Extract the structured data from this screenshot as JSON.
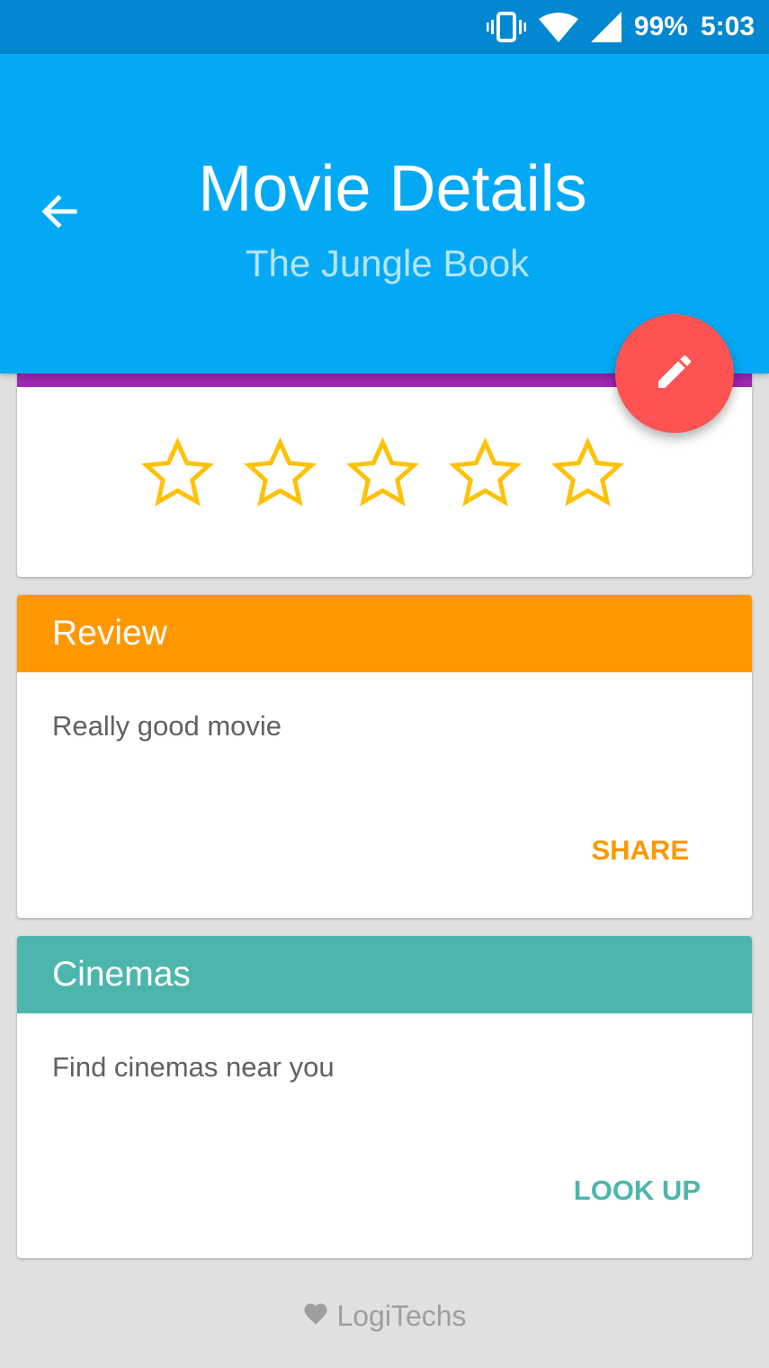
{
  "status_bar": {
    "battery": "99%",
    "time": "5:03",
    "icons": [
      "vibrate-icon",
      "wifi-icon",
      "cell-signal-icon"
    ]
  },
  "app_bar": {
    "back_icon": "arrow-back-icon",
    "title": "Movie Details",
    "subtitle": "The Jungle Book"
  },
  "fab": {
    "icon": "pencil-icon"
  },
  "rating": {
    "max_stars": 5,
    "value": 0,
    "star_icon": "star-outline-icon"
  },
  "review_card": {
    "header": "Review",
    "body": "Really good movie",
    "action": "SHARE"
  },
  "cinemas_card": {
    "header": "Cinemas",
    "body": "Find cinemas near you",
    "action": "LOOK UP"
  },
  "footer": {
    "icon": "heart-icon",
    "text": "LogiTechs"
  },
  "colors": {
    "status_bar": "#0288d1",
    "app_bar": "#03a9f4",
    "subtitle": "#b3e5fc",
    "fab": "#ff5252",
    "rating_strip": "#9c27b0",
    "star": "#ffc107",
    "review_accent": "#ff9800",
    "cinemas_accent": "#4db6ac",
    "background": "#e0e0e0"
  }
}
